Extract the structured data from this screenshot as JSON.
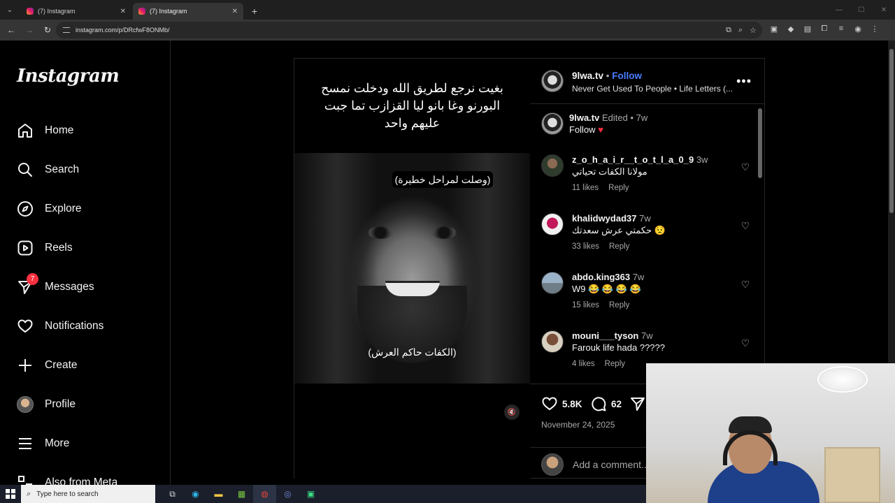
{
  "browser": {
    "tabs": [
      {
        "title": "(7) Instagram",
        "active": false
      },
      {
        "title": "(7) Instagram",
        "active": true
      }
    ],
    "url": "instagram.com/p/DRcfwF8ONMb/"
  },
  "sidebar": {
    "logo": "Instagram",
    "items": [
      {
        "label": "Home",
        "icon": "home-icon"
      },
      {
        "label": "Search",
        "icon": "search-icon"
      },
      {
        "label": "Explore",
        "icon": "compass-icon"
      },
      {
        "label": "Reels",
        "icon": "reels-icon"
      },
      {
        "label": "Messages",
        "icon": "messenger-icon",
        "badge": "7"
      },
      {
        "label": "Notifications",
        "icon": "heart-icon"
      },
      {
        "label": "Create",
        "icon": "plus-icon"
      },
      {
        "label": "Profile",
        "icon": "avatar"
      },
      {
        "label": "More",
        "icon": "menu-icon"
      },
      {
        "label": "Also from Meta",
        "icon": "meta-icon"
      }
    ]
  },
  "post": {
    "video": {
      "caption_top": "بغيت نرجع لطريق الله ودخلت نمسح البورنو وغا بانو ليا القزازب تما جبت عليهم واحد",
      "label_mid": "(وصلت لمراحل خطيرة)",
      "label_bottom": "(الكفات حاكم العرش)"
    },
    "header": {
      "username": "9lwa.tv",
      "separator": "•",
      "follow": "Follow",
      "subtitle": "Never Get Used To People • Life Letters (..."
    },
    "caption": {
      "username": "9lwa.tv",
      "edited": "Edited",
      "separator": "•",
      "time": "7w",
      "text": "Follow",
      "emoji": "♥"
    },
    "comments": [
      {
        "username": "z_o_h_a_i_r__t_o_t_l_a_0_9",
        "time": "3w",
        "text": "مولانا الكفات تحياتي",
        "likes": "11 likes",
        "reply": "Reply"
      },
      {
        "username": "khalidwydad37",
        "time": "7w",
        "text": "حكمتي عرش سعدتك 😟",
        "likes": "33 likes",
        "reply": "Reply"
      },
      {
        "username": "abdo.king363",
        "time": "7w",
        "text": "W9 😂 😂 😂 😂",
        "likes": "15 likes",
        "reply": "Reply"
      },
      {
        "username": "mouni___tyson",
        "time": "7w",
        "text": "Farouk life hada ?????",
        "likes": "4 likes",
        "reply": "Reply"
      }
    ],
    "actions": {
      "likes": "5.8K",
      "comments": "62"
    },
    "date": "November 24, 2025",
    "add_comment_placeholder": "Add a comment..."
  },
  "taskbar": {
    "search_placeholder": "Type here to search"
  }
}
